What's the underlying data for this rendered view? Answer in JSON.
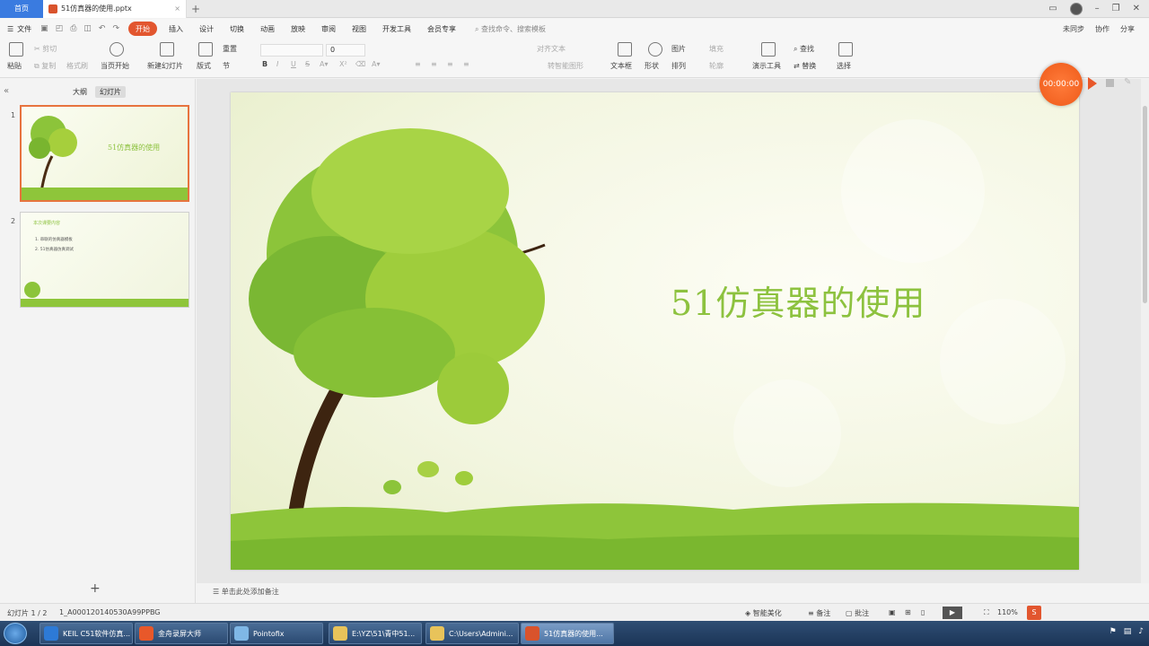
{
  "titlebar": {
    "home_tab": "首页",
    "doc_tab": "51仿真器的使用.pptx",
    "new_tab": "+"
  },
  "menu": {
    "file": "文件",
    "items": [
      "开始",
      "插入",
      "设计",
      "切换",
      "动画",
      "放映",
      "审阅",
      "视图",
      "开发工具",
      "会员专享"
    ],
    "active_index": 0,
    "search": "查找命令、搜索模板",
    "right": [
      "未同步",
      "协作",
      "分享"
    ]
  },
  "toolbar": {
    "paste": "粘贴",
    "cut": "剪切",
    "copy": "复制",
    "format_painter": "格式刷",
    "from_current": "当页开始",
    "new_slide": "新建幻灯片",
    "layout": "版式",
    "reset": "重置",
    "section": "节",
    "font_size": "0",
    "align_text": "对齐文本",
    "smart_art": "转智能图形",
    "text_box": "文本框",
    "shape": "形状",
    "picture": "图片",
    "arrange": "排列",
    "fill": "填充",
    "outline": "轮廓",
    "present_tools": "演示工具",
    "find": "查找",
    "replace": "替换",
    "select": "选择"
  },
  "leftpanel": {
    "outline_tab": "大纲",
    "slides_tab": "幻灯片",
    "thumb1_num": "1",
    "thumb1_title": "51仿真器的使用",
    "thumb2_num": "2",
    "thumb2_heading": "本次课要内容",
    "thumb2_item1": "1.  串联的仿真器模板",
    "thumb2_item2": "2.  51仿真器仿真调试"
  },
  "slide": {
    "title": "51仿真器的使用"
  },
  "recorder": {
    "time": "00:00:00"
  },
  "notes": {
    "placeholder": "单击此处添加备注"
  },
  "statusbar": {
    "slide_pos": "幻灯片 1 / 2",
    "template": "1_A000120140530A99PPBG",
    "beautify": "智能美化",
    "notes": "备注",
    "comments": "批注",
    "zoom": "110%"
  },
  "taskbar": {
    "tasks": [
      "KEIL C51软件仿真...",
      "金舟录屏大师",
      "Pointofix",
      "E:\\YZ\\51\\青中51...",
      "C:\\Users\\Admini...",
      "51仿真器的使用..."
    ],
    "active_index": 5
  },
  "colors": {
    "accent": "#e2562f",
    "title_green": "#8dc23f",
    "taskbar": "#1b3456"
  }
}
